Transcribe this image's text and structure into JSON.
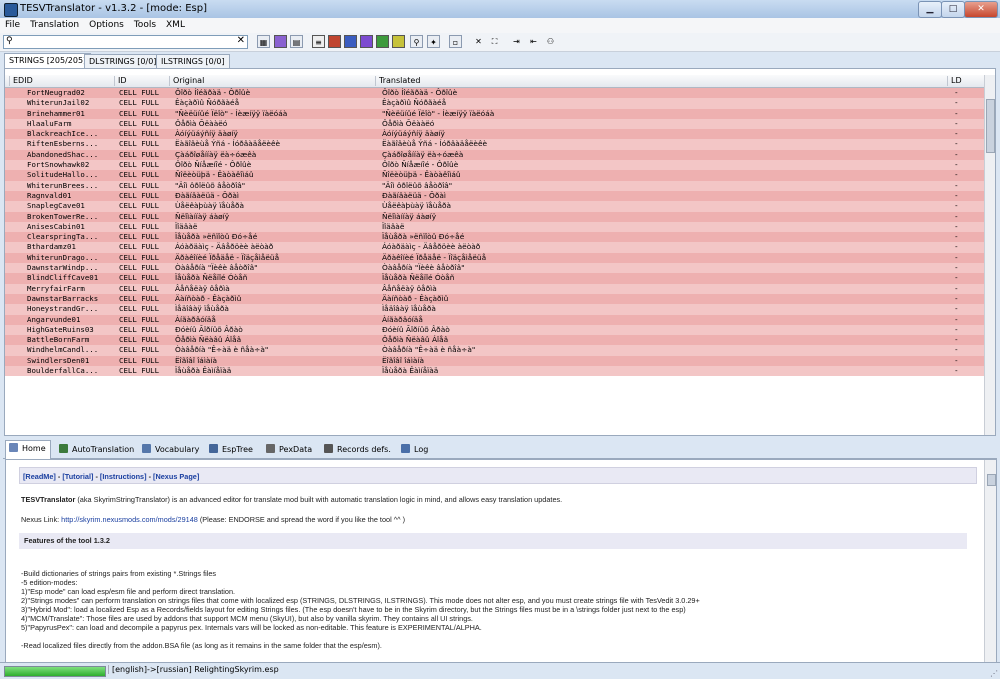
{
  "window": {
    "title": "TESVTranslator - v1.3.2 - [mode: Esp]",
    "min": "▁",
    "max": "□",
    "close": "✕"
  },
  "menu": [
    "File",
    "Translation",
    "Options",
    "Tools",
    "XML"
  ],
  "search": {
    "value": "",
    "icon": "search-icon",
    "clear": "✕"
  },
  "top_tabs": [
    "STRINGS [205/205]",
    "DLSTRINGS [0/0]",
    "ILSTRINGS [0/0]"
  ],
  "grid": {
    "headers": [
      "EDID",
      "ID",
      "Original",
      "Translated",
      "LD"
    ],
    "rows": [
      {
        "edid": "FortNeugrad02",
        "id": "CELL FULL",
        "orig": "Ôîðò Íîéãðàä - Ôðîûè",
        "trans": "Ôîðò Íîéãðàä - Ôðîûè",
        "ld": "-"
      },
      {
        "edid": "WhiterunJail02",
        "id": "CELL FULL",
        "orig": "Êàçàðìû Ñóðãàéå",
        "trans": "Êàçàðìû Ñóðãàéå",
        "ld": "-"
      },
      {
        "edid": "Brinehammer01",
        "id": "CELL FULL",
        "orig": "\"Ñèëüíûé Ïëîò\" - Íèæíÿÿ ïàëóáà",
        "trans": "\"Ñèëüíûé Ïëîò\" - Íèæíÿÿ ïàëóáà",
        "ld": "-"
      },
      {
        "edid": "HlaaluFarm",
        "id": "CELL FULL",
        "orig": "Ôåðìà Õëààëó",
        "trans": "Ôåðìà Õëààëó",
        "ld": "-"
      },
      {
        "edid": "BlackreachIce...",
        "id": "CELL FULL",
        "orig": "Àóíýüáýñíÿ äàøíÿ",
        "trans": "Àóíýüáýñíÿ äàøíÿ",
        "ld": "-"
      },
      {
        "edid": "RiftenEsberns...",
        "id": "CELL FULL",
        "orig": "Ëàãîâèùå Ýñá - Íóðâàäåëèêè",
        "trans": "Ëàãîâèùå Ýñá - Íóðâàäåëèêè",
        "ld": "-"
      },
      {
        "edid": "AbandonedShac...",
        "id": "CELL FULL",
        "orig": "Çàáðîøåííàÿ ëà÷óæêà",
        "trans": "Çàáðîøåííàÿ ëà÷óæêà",
        "ld": "-"
      },
      {
        "edid": "FortSnowhawk02",
        "id": "CELL FULL",
        "orig": "Ôîðò Ñíåæíîé - Ôðîûè",
        "trans": "Ôîðò Ñíåæíîé - Ôðîûè",
        "ld": "-"
      },
      {
        "edid": "SolitudeHallo...",
        "id": "CELL FULL",
        "orig": "Ñîëèòüþä - Êàòàêîìáû",
        "trans": "Ñîëèòüþä - Êàòàêîìáû",
        "ld": "-"
      },
      {
        "edid": "WhiterunBrees...",
        "id": "CELL FULL",
        "orig": "\"Äîì ôðîëûõ âåòðîâ\"",
        "trans": "\"Äîì ôðîëûõ âåòðîâ\"",
        "ld": "-"
      },
      {
        "edid": "Ragnvald01",
        "id": "CELL FULL",
        "orig": "Ðàãíâàëüä - Õðàì",
        "trans": "Ðàãíâàëüä - Õðàì",
        "ld": "-"
      },
      {
        "edid": "SnaplegCave01",
        "id": "CELL FULL",
        "orig": "Ùåëêàþùàÿ ïåùåðà",
        "trans": "Ùåëêàþùàÿ ïåùåðà",
        "ld": "-"
      },
      {
        "edid": "BrokenTowerRe...",
        "id": "CELL FULL",
        "orig": "Ñëîìàííàÿ áàøíÿ",
        "trans": "Ñëîìàííàÿ áàøíÿ",
        "ld": "-"
      },
      {
        "edid": "AnisesCabin01",
        "id": "CELL FULL",
        "orig": "Ïîäâàë",
        "trans": "Ïîäâàë",
        "ld": "-"
      },
      {
        "edid": "ClearspringTa...",
        "id": "CELL FULL",
        "orig": "Ïåùåðà »ëñïîòû Ðó÷åé",
        "trans": "Ïåùåðà »ëñïîòû Ðó÷åé",
        "ld": "-"
      },
      {
        "edid": "Bthardamz01",
        "id": "CELL FULL",
        "orig": "Áóàðäàìç - Äâåðöèè àëòàð",
        "trans": "Áóàðäàìç - Äâåðöèè àëòàð",
        "ld": "-"
      },
      {
        "edid": "WhiterunDrago...",
        "id": "CELL FULL",
        "orig": "Äðàêîíèé Ïðåäåë - Ïîäçåìåëüå",
        "trans": "Äðàêîíèé Ïðåäåë - Ïîäçåìåëüå",
        "ld": "-"
      },
      {
        "edid": "DawnstarWindp...",
        "id": "CELL FULL",
        "orig": "Òàâåðíà \"Ïèêè âåòðîâ\"",
        "trans": "Òàâåðíà \"Ïèêè âåòðîâ\"",
        "ld": "-"
      },
      {
        "edid": "BlindCliffCave01",
        "id": "CELL FULL",
        "orig": "Ïåùåðà Ñëåïîé Óòåñ",
        "trans": "Ïåùåðà Ñëåïîé Óòåñ",
        "ld": "-"
      },
      {
        "edid": "MerryfairFarm",
        "id": "CELL FULL",
        "orig": "Âåñåëàÿ ôåðìà",
        "trans": "Âåñåëàÿ ôåðìà",
        "ld": "-"
      },
      {
        "edid": "DawnstarBarracks",
        "id": "CELL FULL",
        "orig": "Äàíñòàð - Êàçàðìû",
        "trans": "Äàíñòàð - Êàçàðìû",
        "ld": "-"
      },
      {
        "edid": "HoneystrandGr...",
        "id": "CELL FULL",
        "orig": "Ìåäîâàÿ ïåùåðà",
        "trans": "Ìåäîâàÿ ïåùåðà",
        "ld": "-"
      },
      {
        "edid": "Angarvunde01",
        "id": "CELL FULL",
        "orig": "Àíãàðâóíäå",
        "trans": "Àíãàðâóíäå",
        "ld": "-"
      },
      {
        "edid": "HighGateRuins03",
        "id": "CELL FULL",
        "orig": "Ðóèíû Ãîðíûõ Âðàò",
        "trans": "Ðóèíû Ãîðíûõ Âðàò",
        "ld": "-"
      },
      {
        "edid": "BattleBornFarm",
        "id": "CELL FULL",
        "orig": "Ôåðìà Ñëàâû Áîåâ",
        "trans": "Ôåðìà Ñëàâû Áîåâ",
        "ld": "-"
      },
      {
        "edid": "WindhelmCandl...",
        "id": "CELL FULL",
        "orig": "Òàâåðíà \"Ê÷àä è ñåà÷à\"",
        "trans": "Òàâåðíà \"Ê÷àä è ñåà÷à\"",
        "ld": "-"
      },
      {
        "edid": "SwindlersDen01",
        "id": "CELL FULL",
        "orig": "Ëîãîâî îáìàíà",
        "trans": "Ëîãîâî îáìàíà",
        "ld": "-"
      },
      {
        "edid": "BoulderfallCa...",
        "id": "CELL FULL",
        "orig": "Ïåùåðà Êàìíåïàä",
        "trans": "Ïåùåðà Êàìíåïàä",
        "ld": "-"
      }
    ]
  },
  "bottom_tabs": [
    "Home",
    "AutoTranslation",
    "Vocabulary",
    "EspTree",
    "PexData",
    "Records defs.",
    "Log"
  ],
  "panel": {
    "links": [
      "[ReadMe]",
      "[Tutorial]",
      "[Instructions]",
      "[Nexus Page]"
    ],
    "sep": " - ",
    "intro_bold": "TESVTranslator",
    "intro_rest": " (aka SkyrimStringTranslator) is an advanced editor for translate mod built with automatic translation logic in mind, and allows easy translation updates.",
    "nexus_label": "Nexus Link: ",
    "nexus_url": "http://skyrim.nexusmods.com/mods/29148",
    "nexus_rest": " (Please: ENDORSE and spread the word if you like the tool ^^ )",
    "features_title": "Features of the tool 1.3.2",
    "lines": [
      "-Build dictionaries of strings pairs from existing *.Strings files",
      "-5 edition-modes:",
      "1)\"Esp mode\"  can load esp/esm file and perform direct translation.",
      "2)\"Strings modes\"  can perform translation on strings files that come with localized esp (STRINGS, DLSTRINGS, ILSTRINGS). This mode does not alter esp, and you must create strings file with TesVedit 3.0.29+",
      "3)\"Hybrid Mod\": load a localized Esp as a Records/fields layout for editing Strings files. (The esp doesn't have to be in the Skyrim directory, but the Strings files must be in a \\strings folder just next to the esp)",
      "4)\"MCM/Translate\": Those files are used by addons that support MCM menu (SkyUI), but also by vanilla skyrim. They contains all UI strings.",
      "5)\"PapyrusPex\": can load and decompile a papyrus pex. Internals vars will be locked as non-editable. This feature is EXPERIMENTAL/ALPHA.",
      "",
      "-Read localized files directly from the addon.BSA file (as long as it remains in the same folder that the esp/esm)."
    ]
  },
  "status": {
    "progress_pct": 100,
    "text": "[english]->[russian] RelightingSkyrim.esp"
  },
  "colors": {
    "row_odd": "#eeb0b0",
    "row_even": "#f3c6c6",
    "link": "#1a3fa0"
  }
}
